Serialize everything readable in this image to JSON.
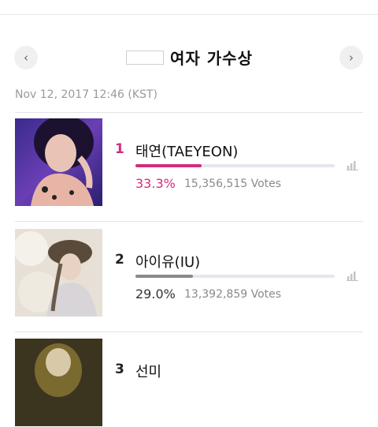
{
  "title": "여자 가수상",
  "timestamp": "Nov 12, 2017 12:46 (KST)",
  "nav": {
    "prev_icon": "chevron-left-icon",
    "next_icon": "chevron-right-icon",
    "prev_glyph": "‹",
    "next_glyph": "›"
  },
  "colors": {
    "accent": "#d12d7d",
    "gray_bar": "#8a8a8a",
    "track": "#e6e6ee"
  },
  "candidates": [
    {
      "rank": "1",
      "name": "태연(TAEYEON)",
      "percent": "33.3%",
      "share": 0.333,
      "votes": "15,356,515 Votes",
      "highlight": true
    },
    {
      "rank": "2",
      "name": "아이유(IU)",
      "percent": "29.0%",
      "share": 0.29,
      "votes": "13,392,859 Votes",
      "highlight": false
    },
    {
      "rank": "3",
      "name": "선미",
      "percent": "",
      "share": null,
      "votes": "",
      "highlight": false
    }
  ]
}
